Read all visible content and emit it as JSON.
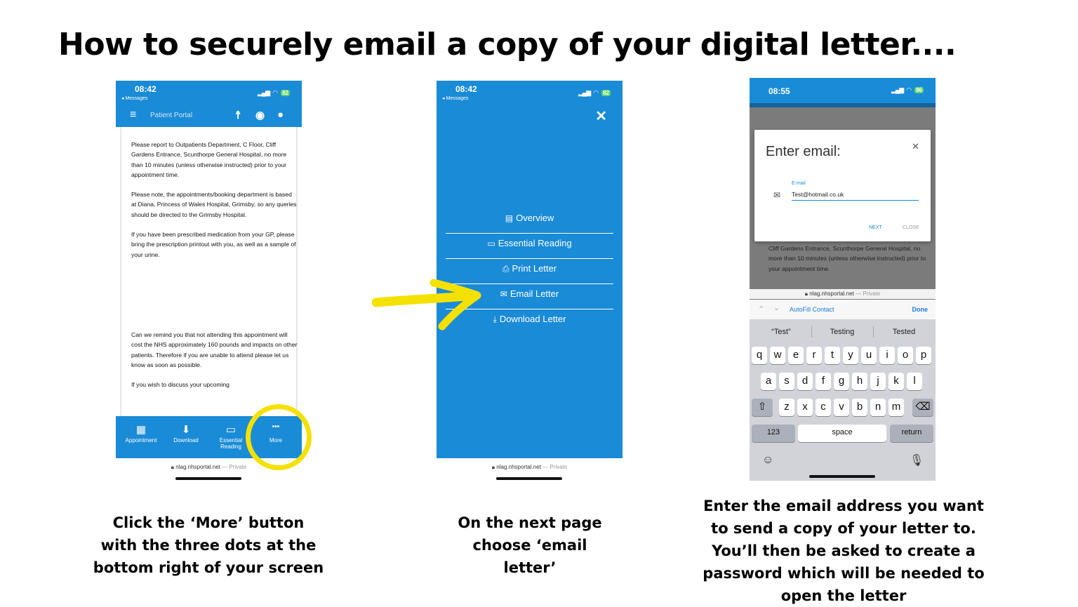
{
  "heading": "How to securely email a copy of your digital letter....",
  "status_left": "◂ Messages",
  "url_host": "nlag.nhsportal.net",
  "url_suffix": "— Private",
  "phone1": {
    "time": "08:42",
    "battery": "82",
    "nav_title": "Patient Portal",
    "paragraphs": [
      "Please report to Outpatients Department, C Floor, Cliff Gardens Entrance, Scunthorpe General Hospital, no more than 10 minutes (unless otherwise instructed) prior to your appointment time.",
      "Please note, the appointments/booking department is based at Diana, Princess of Wales Hospital, Grimsby, so any queries should be directed to the Grimsby Hospital.",
      "If you have been prescribed medication from your GP, please bring the prescription printout with you, as well as a sample of your urine.",
      "Can we remind you that not attending this appointment will cost the NHS approximately 160 pounds and impacts on other patients. Therefore if you are unable to attend please let us know as soon as possible.",
      "If you wish to discuss your upcoming"
    ],
    "tabs": [
      {
        "label": "Appointment",
        "icon": "calendar-icon",
        "glyph": "▦"
      },
      {
        "label": "Download",
        "icon": "download-icon",
        "glyph": "⬇"
      },
      {
        "label": "Essential Reading",
        "icon": "book-icon",
        "glyph": "▭"
      },
      {
        "label": "More",
        "icon": "more-dots-icon",
        "glyph": "•••"
      }
    ]
  },
  "phone2": {
    "time": "08:42",
    "battery": "82",
    "menu": [
      {
        "label": "Overview",
        "icon": "list-icon",
        "glyph": "▤"
      },
      {
        "label": "Essential Reading",
        "icon": "book-icon",
        "glyph": "▭"
      },
      {
        "label": "Print Letter",
        "icon": "printer-icon",
        "glyph": "⎙"
      },
      {
        "label": "Email Letter",
        "icon": "envelope-icon",
        "glyph": "✉"
      },
      {
        "label": "Download Letter",
        "icon": "download-icon",
        "glyph": "⤓"
      }
    ]
  },
  "phone3": {
    "time": "08:55",
    "battery": "86",
    "dialog_title": "Enter email:",
    "field_label": "E-mail",
    "field_value": "Test@hotmail.co.uk",
    "next_label": "NEXT",
    "close_label": "CLOSE",
    "behind_text": "Cliff Gardens Entrance, Scunthorpe General Hospital, no more than 10 minutes (unless otherwise instructed) prior to your appointment time.",
    "autofill_label": "AutoFill Contact",
    "done_label": "Done",
    "suggestions": [
      "“Test”",
      "Testing",
      "Tested"
    ],
    "row1": [
      "q",
      "w",
      "e",
      "r",
      "t",
      "y",
      "u",
      "i",
      "o",
      "p"
    ],
    "row2": [
      "a",
      "s",
      "d",
      "f",
      "g",
      "h",
      "j",
      "k",
      "l"
    ],
    "row3": [
      "z",
      "x",
      "c",
      "v",
      "b",
      "n",
      "m"
    ],
    "key_123": "123",
    "key_space": "space",
    "key_return": "return"
  },
  "captions": {
    "step1": "Click the ‘More’ button with the three dots at the bottom right of your screen",
    "step2": "On the next page choose ‘email letter’",
    "step3": "Enter the email address you want to send a copy of your letter to. You’ll then be asked to create a password which will be needed to open the letter"
  },
  "colors": {
    "app_blue": "#1a8bd6",
    "highlight_yellow": "#f5e100"
  }
}
